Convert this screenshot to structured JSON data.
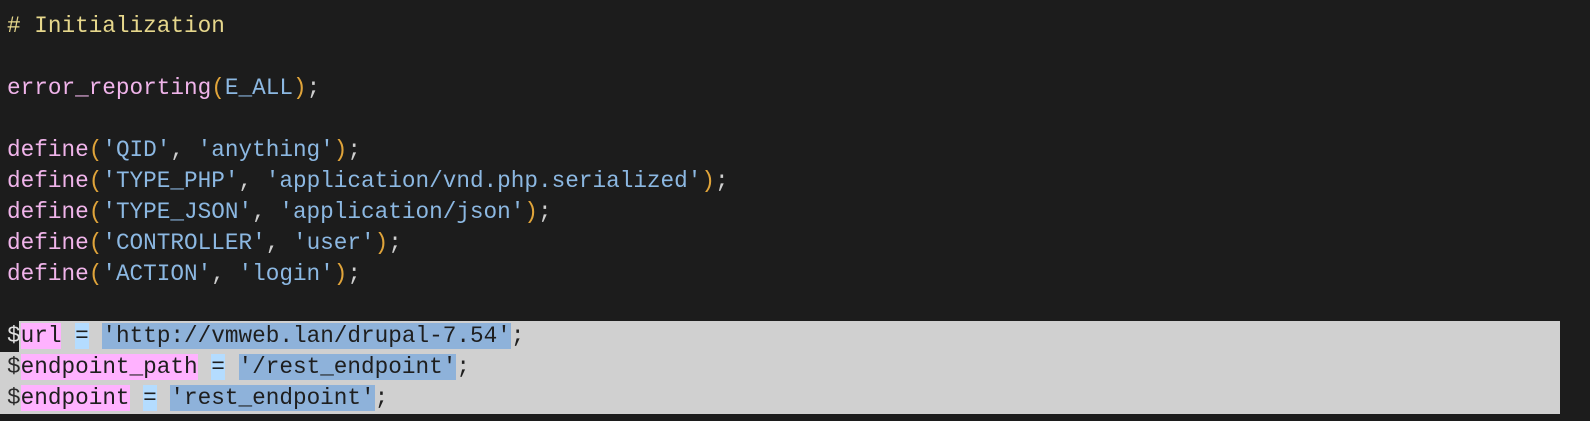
{
  "editor": {
    "lines": [
      {
        "tokens": [
          [
            "# Initialization",
            "comment"
          ]
        ]
      },
      {
        "tokens": []
      },
      {
        "tokens": [
          [
            "error_reporting",
            "fn"
          ],
          [
            "(",
            "paren"
          ],
          [
            "E_ALL",
            "const"
          ],
          [
            ")",
            "paren"
          ],
          [
            ";",
            "punct"
          ]
        ]
      },
      {
        "tokens": []
      },
      {
        "tokens": [
          [
            "define",
            "fn"
          ],
          [
            "(",
            "paren"
          ],
          [
            "'QID'",
            "str"
          ],
          [
            ", ",
            "punct"
          ],
          [
            "'anything'",
            "str"
          ],
          [
            ")",
            "paren"
          ],
          [
            ";",
            "punct"
          ]
        ]
      },
      {
        "tokens": [
          [
            "define",
            "fn"
          ],
          [
            "(",
            "paren"
          ],
          [
            "'TYPE_PHP'",
            "str"
          ],
          [
            ", ",
            "punct"
          ],
          [
            "'application/vnd.php.serialized'",
            "str"
          ],
          [
            ")",
            "paren"
          ],
          [
            ";",
            "punct"
          ]
        ]
      },
      {
        "tokens": [
          [
            "define",
            "fn"
          ],
          [
            "(",
            "paren"
          ],
          [
            "'TYPE_JSON'",
            "str"
          ],
          [
            ", ",
            "punct"
          ],
          [
            "'application/json'",
            "str"
          ],
          [
            ")",
            "paren"
          ],
          [
            ";",
            "punct"
          ]
        ]
      },
      {
        "tokens": [
          [
            "define",
            "fn"
          ],
          [
            "(",
            "paren"
          ],
          [
            "'CONTROLLER'",
            "str"
          ],
          [
            ", ",
            "punct"
          ],
          [
            "'user'",
            "str"
          ],
          [
            ")",
            "paren"
          ],
          [
            ";",
            "punct"
          ]
        ]
      },
      {
        "tokens": [
          [
            "define",
            "fn"
          ],
          [
            "(",
            "paren"
          ],
          [
            "'ACTION'",
            "str"
          ],
          [
            ", ",
            "punct"
          ],
          [
            "'login'",
            "str"
          ],
          [
            ")",
            "paren"
          ],
          [
            ";",
            "punct"
          ]
        ]
      },
      {
        "tokens": []
      },
      {
        "selected": "first",
        "tokens": [
          [
            "$",
            "dollar first-dollar"
          ],
          [
            "url",
            "var"
          ],
          [
            " ",
            "ws"
          ],
          [
            "=",
            "op"
          ],
          [
            " ",
            "ws"
          ],
          [
            "'http://vmweb.lan/drupal-7.54'",
            "str"
          ],
          [
            ";",
            "punct"
          ]
        ]
      },
      {
        "selected": "full",
        "tokens": [
          [
            "$",
            "dollar"
          ],
          [
            "endpoint_path",
            "var"
          ],
          [
            " ",
            "ws"
          ],
          [
            "=",
            "op"
          ],
          [
            " ",
            "ws"
          ],
          [
            "'/rest_endpoint'",
            "str"
          ],
          [
            ";",
            "punct"
          ]
        ]
      },
      {
        "selected": "full",
        "tokens": [
          [
            "$",
            "dollar"
          ],
          [
            "endpoint",
            "var"
          ],
          [
            " ",
            "ws"
          ],
          [
            "=",
            "op"
          ],
          [
            " ",
            "ws"
          ],
          [
            "'rest_endpoint'",
            "str"
          ],
          [
            ";",
            "punct"
          ]
        ]
      }
    ]
  }
}
